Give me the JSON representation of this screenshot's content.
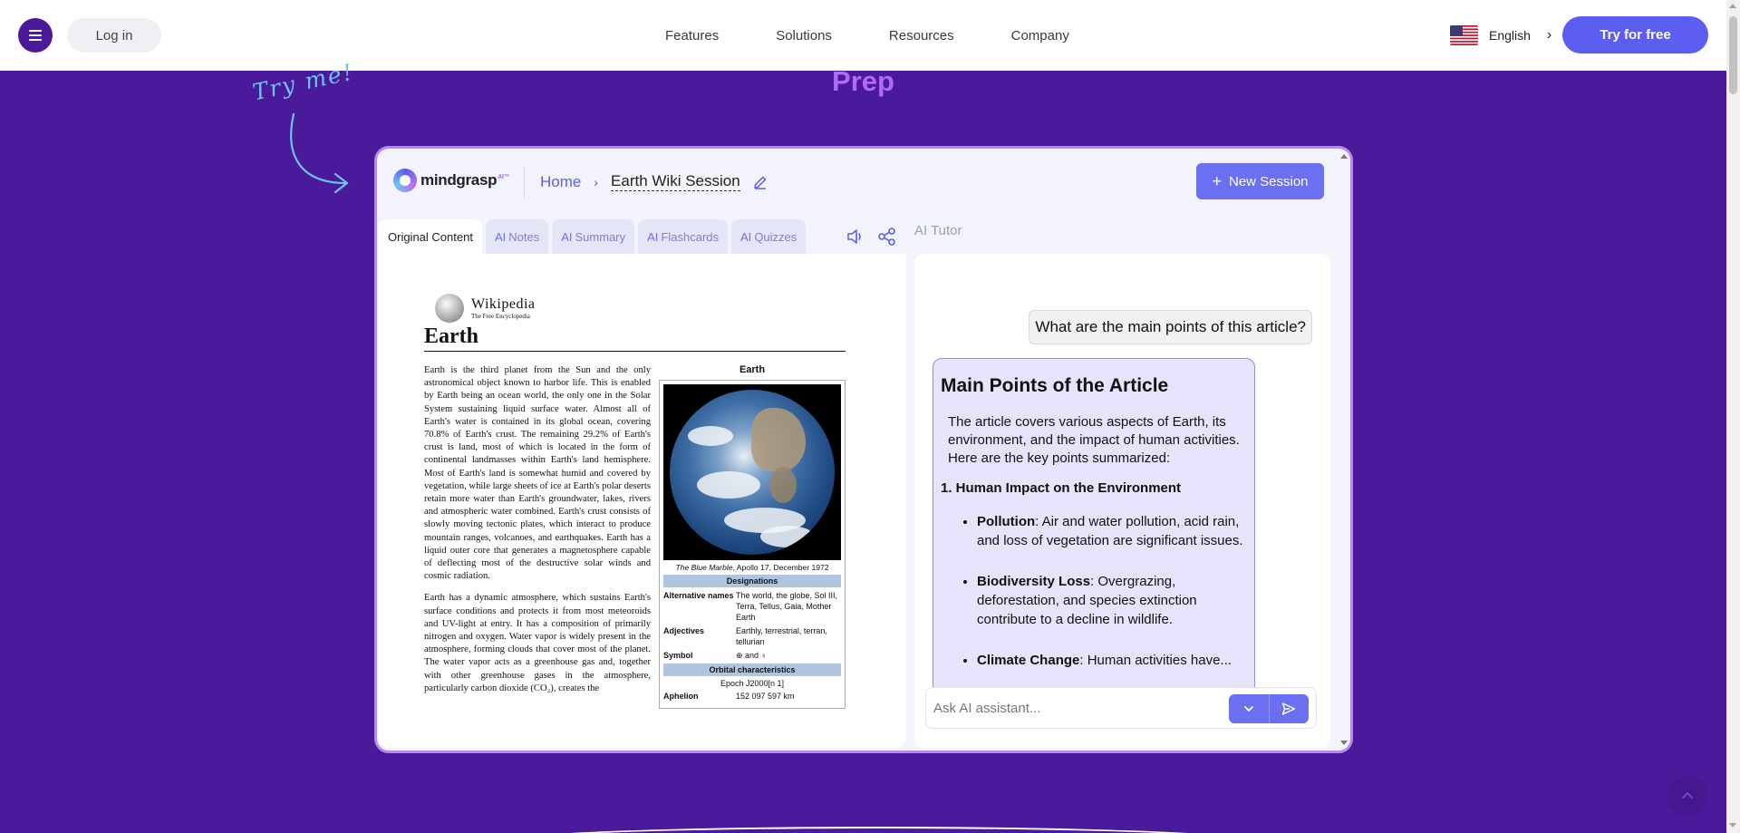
{
  "nav": {
    "login": "Log in",
    "links": [
      "Features",
      "Solutions",
      "Resources",
      "Company"
    ],
    "language": "English",
    "cta": "Try for free"
  },
  "section": {
    "heading": "Prep",
    "doodle": "Try me!"
  },
  "app": {
    "logo": "mindgrasp",
    "logo_ai": "AI™",
    "breadcrumb": {
      "home": "Home",
      "current": "Earth Wiki Session"
    },
    "new_session": "New Session",
    "tabs": [
      {
        "prefix": "",
        "label": "Original Content"
      },
      {
        "prefix": "AI",
        "label": "Notes"
      },
      {
        "prefix": "AI",
        "label": "Summary"
      },
      {
        "prefix": "AI",
        "label": "Flashcards"
      },
      {
        "prefix": "AI",
        "label": "Quizzes"
      }
    ],
    "tutor_label": "AI Tutor"
  },
  "wiki": {
    "brand": "Wikipedia",
    "tagline": "The Free Encyclopedia",
    "title": "Earth",
    "p1": "Earth is the third planet from the Sun and the only astronomical object known to harbor life. This is enabled by Earth being an ocean world, the only one in the Solar System sustaining liquid surface water. Almost all of Earth's water is contained in its global ocean, covering 70.8% of Earth's crust. The remaining 29.2% of Earth's crust is land, most of which is located in the form of continental landmasses within Earth's land hemisphere. Most of Earth's land is somewhat humid and covered by vegetation, while large sheets of ice at Earth's polar deserts retain more water than Earth's groundwater, lakes, rivers and atmospheric water combined. Earth's crust consists of slowly moving tectonic plates, which interact to produce mountain ranges, volcanoes, and earthquakes. Earth has a liquid outer core that generates a magnetosphere capable of deflecting most of the destructive solar winds and cosmic radiation.",
    "p2": "Earth has a dynamic atmosphere, which sustains Earth's surface conditions and protects it from most meteoroids and UV-light at entry. It has a composition of primarily nitrogen and oxygen. Water vapor is widely present in the atmosphere, forming clouds that cover most of the planet. The water vapor acts as a greenhouse gas and, together with other greenhouse gases in the atmosphere, particularly carbon dioxide (CO₂), creates the",
    "infobox": {
      "title": "Earth",
      "caption_italic": "The Blue Marble",
      "caption_rest": ", Apollo 17, December 1972",
      "sec_designations": "Designations",
      "alt_names_key": "Alternative names",
      "alt_names_val": "The world, the globe, Sol III, Terra, Tellus, Gaia, Mother Earth",
      "adjectives_key": "Adjectives",
      "adjectives_val": "Earthly, terrestrial, terran, tellurian",
      "symbol_key": "Symbol",
      "symbol_val": "⊕ and ♁",
      "sec_orbital": "Orbital characteristics",
      "epoch": "Epoch J2000[n 1]",
      "aphelion_key": "Aphelion",
      "aphelion_val": "152 097 597 km"
    }
  },
  "chat": {
    "user_question": "What are the main points of this article?",
    "answer_title": "Main Points of the Article",
    "answer_intro": "The article covers various aspects of Earth, its environment, and the impact of human activities. Here are the key points summarized:",
    "point_heading": "1. Human Impact on the Environment",
    "bullets": [
      {
        "term": "Pollution",
        "text": ": Air and water pollution, acid rain, and loss of vegetation are significant issues."
      },
      {
        "term": "Biodiversity Loss",
        "text": ": Overgrazing, deforestation, and species extinction contribute to a decline in wildlife."
      },
      {
        "term": "Climate Change",
        "text": ": Human activities have..."
      }
    ],
    "input_placeholder": "Ask AI assistant..."
  },
  "colors": {
    "page_bg": "#4a1a9a",
    "accent": "#5b5ef0",
    "heading": "#b06bf2",
    "frame_border": "#b689f0"
  }
}
